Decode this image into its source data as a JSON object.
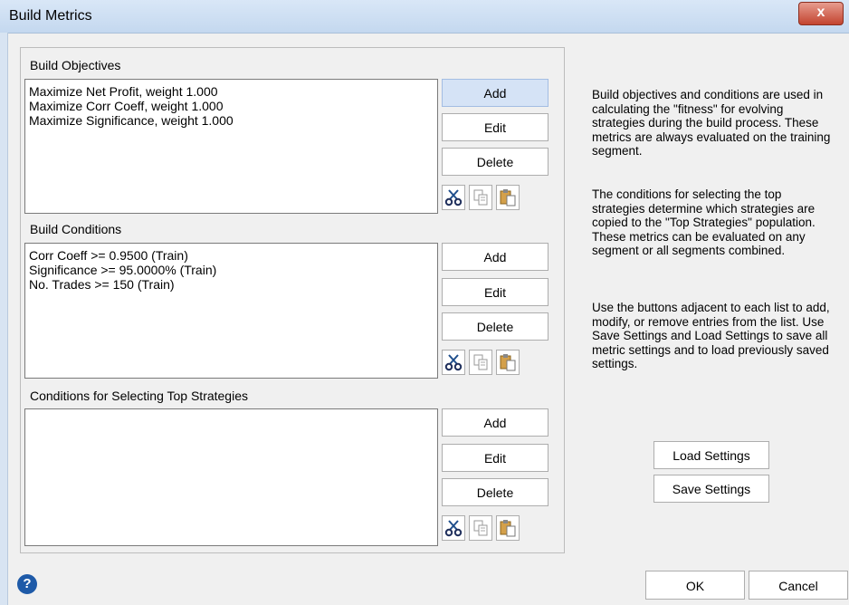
{
  "window": {
    "title": "Build Metrics",
    "close_label": "x"
  },
  "objectives": {
    "label": "Build Objectives",
    "items": [
      "Maximize Net Profit, weight 1.000",
      "Maximize Corr Coeff, weight 1.000",
      "Maximize Significance, weight 1.000"
    ],
    "add": "Add",
    "edit": "Edit",
    "delete": "Delete"
  },
  "conditions": {
    "label": "Build Conditions",
    "items": [
      "Corr Coeff >=  0.9500 (Train)",
      "Significance >=  95.0000% (Train)",
      "No. Trades >=  150 (Train)"
    ],
    "add": "Add",
    "edit": "Edit",
    "delete": "Delete"
  },
  "top": {
    "label": "Conditions for Selecting Top Strategies",
    "items": [],
    "add": "Add",
    "edit": "Edit",
    "delete": "Delete"
  },
  "help": {
    "p1": "Build objectives and conditions are used in calculating the \"fitness\" for evolving strategies during the build process. These metrics are always evaluated on the training segment.",
    "p2": "The conditions for selecting the top strategies determine which strategies are copied to the \"Top Strategies\" population. These metrics can be evaluated on any segment or all segments combined.",
    "p3": "Use the buttons adjacent to each list to add, modify, or remove entries from the list. Use Save Settings and Load Settings to save all metric settings and to load previously saved settings."
  },
  "settings": {
    "load": "Load Settings",
    "save": "Save Settings"
  },
  "footer": {
    "ok": "OK",
    "cancel": "Cancel",
    "help_glyph": "?"
  },
  "icons": {
    "cut": "scissors-icon",
    "copy": "copy-icon",
    "paste": "paste-icon"
  }
}
